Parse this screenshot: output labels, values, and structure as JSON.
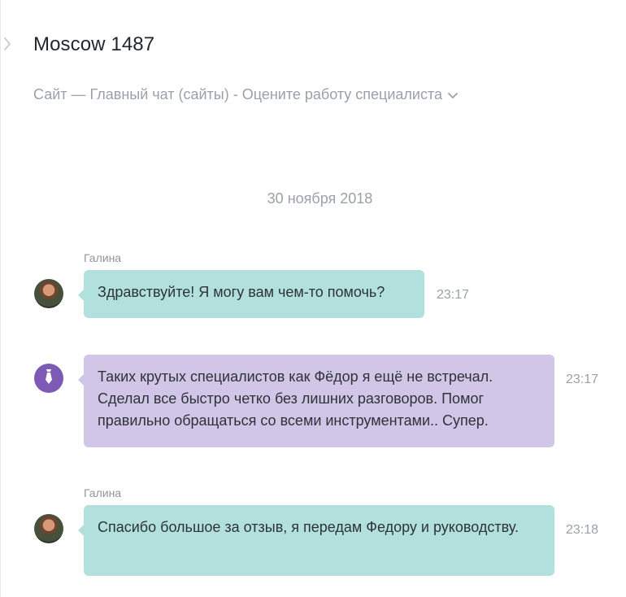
{
  "chat": {
    "title": "Moscow 1487",
    "subtitle": "Сайт — Главный чат (сайты) - Оцените работу специалиста",
    "date_separator": "30 ноября 2018"
  },
  "messages": [
    {
      "sender": "Галина",
      "text": "Здравствуйте! Я могу вам чем-то помочь?",
      "time": "23:17",
      "avatar": "user-photo",
      "bubble_color": "#b1e0dd"
    },
    {
      "sender": "",
      "text": "Таких крутых специалистов как Фёдор я ещё не встречал. Сделал все быстро четко без лишних разговоров. Помог правильно обращаться со всеми инструментами.. Супер.",
      "time": "23:17",
      "avatar": "tie-icon",
      "bubble_color": "#d1c5e8"
    },
    {
      "sender": "Галина",
      "text": "Спасибо большое за отзыв, я передам Федору и руководству.",
      "time": "23:18",
      "avatar": "user-photo",
      "bubble_color": "#b1e0dd"
    }
  ],
  "icons": {
    "collapse": "chevron-right-icon",
    "subtitle_dropdown": "chevron-down-icon",
    "bot_avatar": "tie-icon"
  }
}
